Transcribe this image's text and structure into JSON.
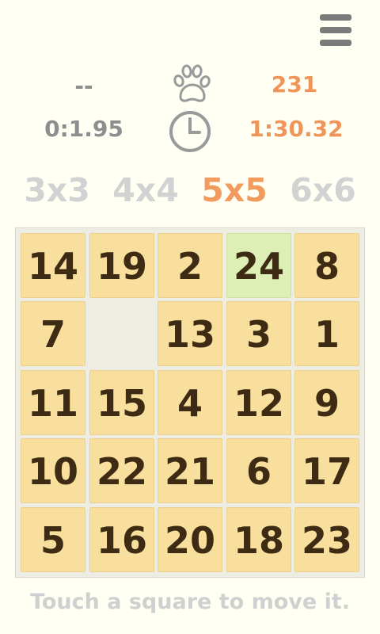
{
  "menu": {
    "icon": "hamburger-menu-icon"
  },
  "stats": {
    "moves_best": "--",
    "moves_current": "231",
    "time_best": "0:1.95",
    "time_current": "1:30.32",
    "moves_icon": "paw-print-icon",
    "time_icon": "clock-icon"
  },
  "sizes": [
    {
      "label": "3x3",
      "active": false
    },
    {
      "label": "4x4",
      "active": false
    },
    {
      "label": "5x5",
      "active": true
    },
    {
      "label": "6x6",
      "active": false
    }
  ],
  "board": {
    "grid": 5,
    "tiles": [
      [
        "14",
        "19",
        "2",
        "24",
        "8"
      ],
      [
        "7",
        "",
        "13",
        "3",
        "1"
      ],
      [
        "11",
        "15",
        "4",
        "12",
        "9"
      ],
      [
        "10",
        "22",
        "21",
        "6",
        "17"
      ],
      [
        "5",
        "16",
        "20",
        "18",
        "23"
      ]
    ],
    "highlighted": "24"
  },
  "hint": "Touch a square to move it.",
  "colors": {
    "background": "#FFFFF3",
    "tile": "#F8DF9D",
    "tile_highlight": "#DDEFB4",
    "accent": "#F29B5E",
    "stat_gray": "#8E8E8E"
  }
}
